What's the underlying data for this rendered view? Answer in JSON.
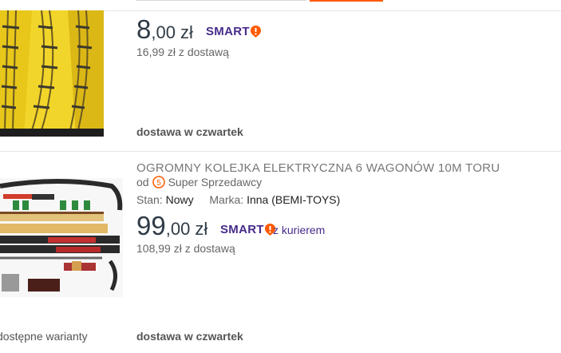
{
  "listing1": {
    "price_int": "8",
    "price_dec": ",00",
    "currency": "zł",
    "smart_label": "SMART",
    "price_with_delivery": "16,99 zł z dostawą",
    "delivery": "dostawa w czwartek"
  },
  "listing2": {
    "title": "OGROMNY KOLEJKA ELEKTRYCZNA 6 WAGONÓW 10M TORU",
    "seller_prefix": "od",
    "seller_label": "Super Sprzedawcy",
    "condition_label": "Stan:",
    "condition_value": "Nowy",
    "brand_label": "Marka:",
    "brand_value": "Inna (BEMI-TOYS)",
    "price_int": "99",
    "price_dec": ",00",
    "currency": "zł",
    "smart_label": "SMART",
    "courier": "z kurierem",
    "price_with_delivery": "108,99 zł z dostawą",
    "variants": "dostępne warianty",
    "delivery": "dostawa w czwartek"
  },
  "colors": {
    "smart": "#472b8a",
    "smart_bang": "#ff5a00",
    "accent": "#ff5a00"
  },
  "icons": [
    "smart-exclamation-icon",
    "super-seller-badge-icon"
  ]
}
